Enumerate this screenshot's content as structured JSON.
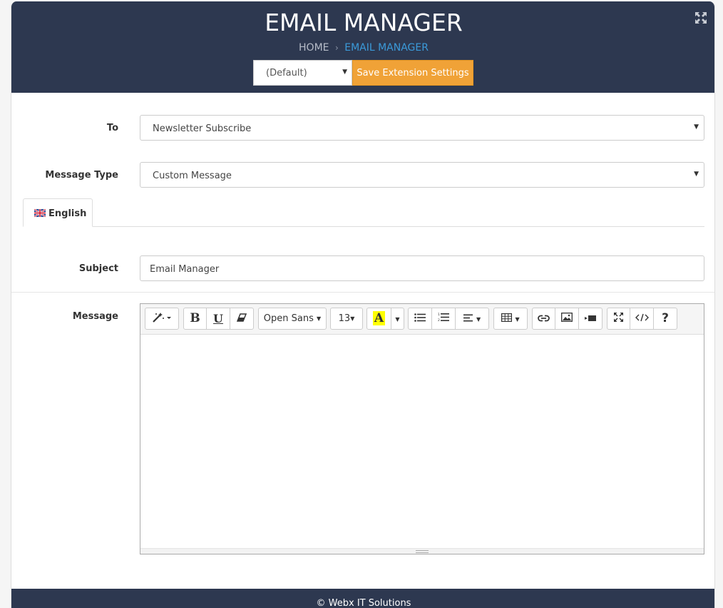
{
  "header": {
    "title": "EMAIL MANAGER",
    "breadcrumb": {
      "home": "HOME",
      "separator": "›",
      "current": "EMAIL MANAGER"
    },
    "store_select": "(Default)",
    "save_button": "Save Extension Settings"
  },
  "form": {
    "to_label": "To",
    "to_value": "Newsletter Subscribe",
    "message_type_label": "Message Type",
    "message_type_value": "Custom Message",
    "language_tab": "English",
    "subject_label": "Subject",
    "subject_value": "Email Manager",
    "message_label": "Message"
  },
  "editor": {
    "font_name": "Open Sans",
    "font_size": "13",
    "bold": "B",
    "underline": "U",
    "color_letter": "A",
    "help": "?"
  },
  "footer": {
    "text": "© Webx IT Solutions"
  },
  "colors": {
    "header_bg": "#2d3850",
    "accent": "#f0a237",
    "link": "#3b9ad9"
  }
}
